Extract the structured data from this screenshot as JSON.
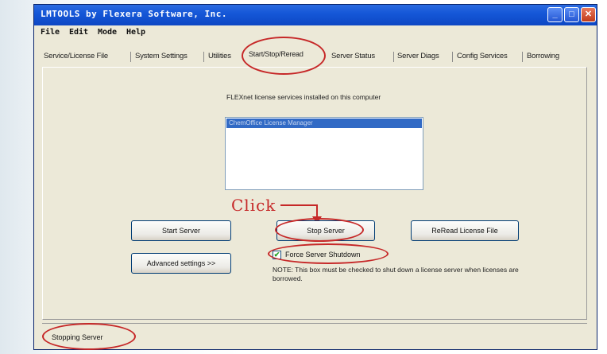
{
  "window": {
    "title": "LMTOOLS by Flexera Software, Inc.",
    "controls": {
      "minimize": "_",
      "maximize": "□",
      "close": "✕"
    }
  },
  "menu": [
    {
      "label": "File"
    },
    {
      "label": "Edit"
    },
    {
      "label": "Mode"
    },
    {
      "label": "Help"
    }
  ],
  "tabs": [
    {
      "label": "Service/License File"
    },
    {
      "label": "System Settings"
    },
    {
      "label": "Utilities"
    },
    {
      "label": "Start/Stop/Reread",
      "active": true
    },
    {
      "label": "Server Status"
    },
    {
      "label": "Server Diags"
    },
    {
      "label": "Config Services"
    },
    {
      "label": "Borrowing"
    }
  ],
  "panel": {
    "services_label": "FLEXnet license services installed on this computer",
    "services": [
      {
        "label": "ChemOffice License Manager",
        "selected": true
      }
    ],
    "buttons": {
      "start_server": "Start Server",
      "stop_server": "Stop Server",
      "reread_license": "ReRead License File",
      "advanced_settings": "Advanced settings >>"
    },
    "force_shutdown": {
      "label": "Force Server Shutdown",
      "checked": true,
      "check_glyph": "✔"
    },
    "note": "NOTE:  This box must be checked to shut down a license server when licenses are borrowed."
  },
  "annotation": {
    "click_label": "Click",
    "color": "#c62828"
  },
  "status": {
    "text": "Stopping Server"
  }
}
